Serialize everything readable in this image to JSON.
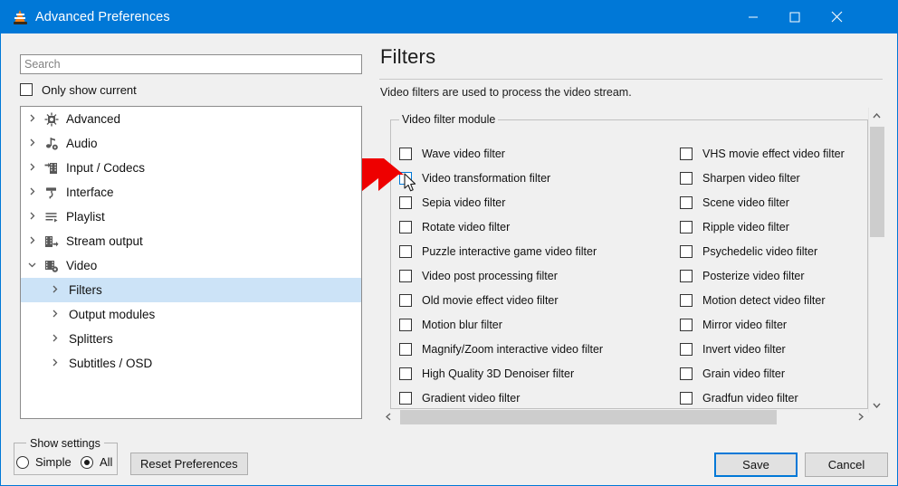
{
  "window": {
    "title": "Advanced Preferences",
    "app_icon": "vlc-cone-icon",
    "accent_color": "#0078d7",
    "controls": {
      "minimize": "—",
      "maximize": "☐",
      "close": "✕"
    }
  },
  "left_pane": {
    "search": {
      "placeholder": "Search",
      "value": ""
    },
    "only_show_current": {
      "label": "Only show current",
      "checked": false
    },
    "tree": [
      {
        "label": "Advanced",
        "icon": "chip-icon",
        "expanded": false,
        "level": 0,
        "selected": false
      },
      {
        "label": "Audio",
        "icon": "music-note-icon",
        "expanded": false,
        "level": 0,
        "selected": false
      },
      {
        "label": "Input / Codecs",
        "icon": "film-input-icon",
        "expanded": false,
        "level": 0,
        "selected": false
      },
      {
        "label": "Interface",
        "icon": "paint-roller-icon",
        "expanded": false,
        "level": 0,
        "selected": false
      },
      {
        "label": "Playlist",
        "icon": "playlist-icon",
        "expanded": false,
        "level": 0,
        "selected": false
      },
      {
        "label": "Stream output",
        "icon": "stream-output-icon",
        "expanded": false,
        "level": 0,
        "selected": false
      },
      {
        "label": "Video",
        "icon": "video-gear-icon",
        "expanded": true,
        "level": 0,
        "selected": false
      },
      {
        "label": "Filters",
        "icon": "",
        "expanded": false,
        "level": 1,
        "selected": true
      },
      {
        "label": "Output modules",
        "icon": "",
        "expanded": false,
        "level": 1,
        "selected": false
      },
      {
        "label": "Splitters",
        "icon": "",
        "expanded": false,
        "level": 1,
        "selected": false
      },
      {
        "label": "Subtitles / OSD",
        "icon": "",
        "expanded": false,
        "level": 1,
        "selected": false
      }
    ],
    "show_settings": {
      "title": "Show settings",
      "options": [
        {
          "label": "Simple",
          "selected": false
        },
        {
          "label": "All",
          "selected": true
        }
      ]
    },
    "reset_preferences_label": "Reset Preferences"
  },
  "right_pane": {
    "title": "Filters",
    "description": "Video filters are used to process the video stream.",
    "group_title": "Video filter module",
    "filters_left": [
      {
        "label": "Wave video filter",
        "checked": false,
        "focused": false
      },
      {
        "label": "Video transformation filter",
        "checked": false,
        "focused": true
      },
      {
        "label": "Sepia video filter",
        "checked": false,
        "focused": false
      },
      {
        "label": "Rotate video filter",
        "checked": false,
        "focused": false
      },
      {
        "label": "Puzzle interactive game video filter",
        "checked": false,
        "focused": false
      },
      {
        "label": "Video post processing filter",
        "checked": false,
        "focused": false
      },
      {
        "label": "Old movie effect video filter",
        "checked": false,
        "focused": false
      },
      {
        "label": "Motion blur filter",
        "checked": false,
        "focused": false
      },
      {
        "label": "Magnify/Zoom interactive video filter",
        "checked": false,
        "focused": false
      },
      {
        "label": "High Quality 3D Denoiser filter",
        "checked": false,
        "focused": false
      },
      {
        "label": "Gradient video filter",
        "checked": false,
        "focused": false
      }
    ],
    "filters_right": [
      {
        "label": "VHS movie effect video filter",
        "checked": false,
        "focused": false
      },
      {
        "label": "Sharpen video filter",
        "checked": false,
        "focused": false
      },
      {
        "label": "Scene video filter",
        "checked": false,
        "focused": false
      },
      {
        "label": "Ripple video filter",
        "checked": false,
        "focused": false
      },
      {
        "label": "Psychedelic video filter",
        "checked": false,
        "focused": false
      },
      {
        "label": "Posterize video filter",
        "checked": false,
        "focused": false
      },
      {
        "label": "Motion detect video filter",
        "checked": false,
        "focused": false
      },
      {
        "label": "Mirror video filter",
        "checked": false,
        "focused": false
      },
      {
        "label": "Invert video filter",
        "checked": false,
        "focused": false
      },
      {
        "label": "Grain video filter",
        "checked": false,
        "focused": false
      },
      {
        "label": "Gradfun video filter",
        "checked": false,
        "focused": false
      }
    ],
    "scrollbars": {
      "vertical_up": "⌃",
      "vertical_down": "⌄",
      "horizontal_left": "‹",
      "horizontal_right": "›"
    }
  },
  "footer": {
    "save_label": "Save",
    "cancel_label": "Cancel"
  },
  "annotation": {
    "arrow_color": "#ee0000",
    "points_at": "Video transformation filter"
  }
}
